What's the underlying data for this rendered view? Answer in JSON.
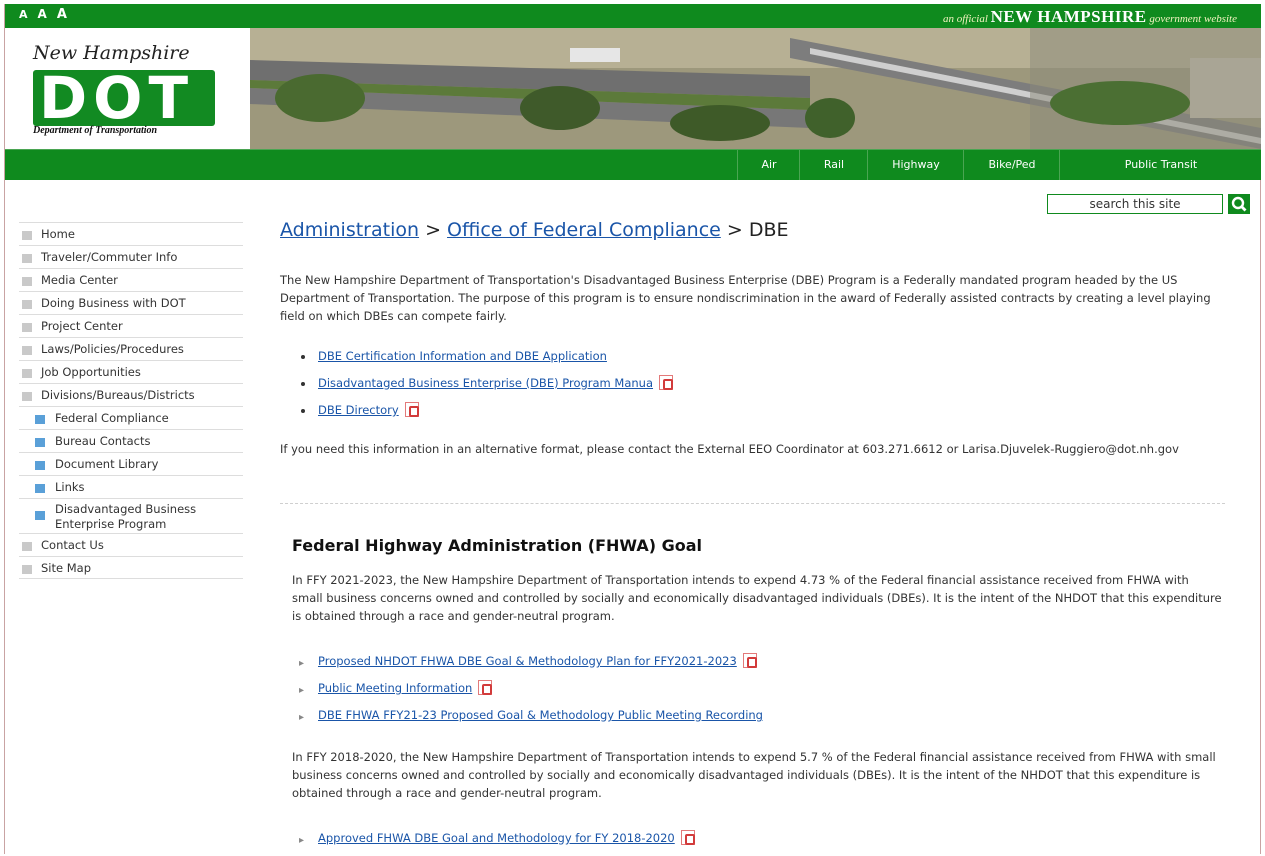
{
  "topbar": {
    "font_sizes": [
      "A",
      "A",
      "A"
    ],
    "official_prefix": "an official",
    "official_name": "NEW HAMPSHIRE",
    "official_suffix": "government website"
  },
  "logo": {
    "script": "New Hampshire",
    "letters": "DOT",
    "department": "Department of Transportation"
  },
  "nav": [
    "Air",
    "Rail",
    "Highway",
    "Bike/Ped",
    "Public Transit"
  ],
  "search": {
    "placeholder": "search this site"
  },
  "sidebar": {
    "items": [
      {
        "label": "Home"
      },
      {
        "label": "Traveler/Commuter Info"
      },
      {
        "label": "Media Center"
      },
      {
        "label": "Doing Business with DOT"
      },
      {
        "label": "Project Center"
      },
      {
        "label": "Laws/Policies/Procedures"
      },
      {
        "label": "Job Opportunities"
      },
      {
        "label": "Divisions/Bureaus/Districts"
      }
    ],
    "sub_items": [
      {
        "label": "Federal Compliance"
      },
      {
        "label": "Bureau Contacts"
      },
      {
        "label": "Document Library"
      },
      {
        "label": "Links"
      },
      {
        "label": "Disadvantaged Business Enterprise Program"
      }
    ],
    "after_items": [
      {
        "label": "Contact Us"
      },
      {
        "label": "Site Map"
      }
    ]
  },
  "breadcrumb": {
    "level1": "Administration",
    "sep1": " > ",
    "level2": "Office of Federal Compliance",
    "sep2": " > ",
    "current": "DBE"
  },
  "intro": "The New Hampshire Department of Transportation's Disadvantaged Business Enterprise (DBE) Program is a Federally mandated program headed by the US Department of Transportation. The purpose of this program is to ensure nondiscrimination in the award of Federally assisted contracts by creating a level playing field on which DBEs can compete fairly.",
  "intro_links": [
    {
      "label": "DBE Certification Information and DBE Application",
      "pdf": false
    },
    {
      "label": "Disadvantaged Business Enterprise (DBE) Program Manua",
      "pdf": true
    },
    {
      "label": "DBE Directory",
      "pdf": true
    }
  ],
  "alt_format": "If you need this information in an alternative format, please contact the External EEO Coordinator at 603.271.6612 or Larisa.Djuvelek-Ruggiero@dot.nh.gov",
  "fhwa": {
    "heading": "Federal Highway Administration (FHWA) Goal",
    "p1": "In FFY 2021-2023, the New Hampshire Department of Transportation intends to expend 4.73 % of the Federal financial assistance received from FHWA with small business concerns owned and controlled by socially and economically disadvantaged individuals (DBEs). It is the intent of the NHDOT that this expenditure is obtained through a race and gender-neutral program.",
    "links1": [
      {
        "label": "Proposed NHDOT FHWA DBE Goal & Methodology Plan for FFY2021-2023",
        "pdf": true
      },
      {
        "label": "Public Meeting Information",
        "pdf": true
      },
      {
        "label": "DBE FHWA FFY21-23 Proposed Goal & Methodology Public Meeting Recording",
        "pdf": false
      }
    ],
    "p2": "In FFY 2018-2020, the New Hampshire Department of Transportation intends to expend 5.7 % of the Federal financial assistance received from FHWA with small business concerns owned and controlled by socially and economically disadvantaged individuals (DBEs).  It is the intent of the NHDOT that this expenditure is obtained through a race and gender-neutral program.",
    "links2": [
      {
        "label": "Approved FHWA DBE Goal and Methodology for FY 2018-2020",
        "pdf": true
      }
    ]
  },
  "colors": {
    "brand_green": "#0f8a1e",
    "link_blue": "#1a55a8"
  }
}
